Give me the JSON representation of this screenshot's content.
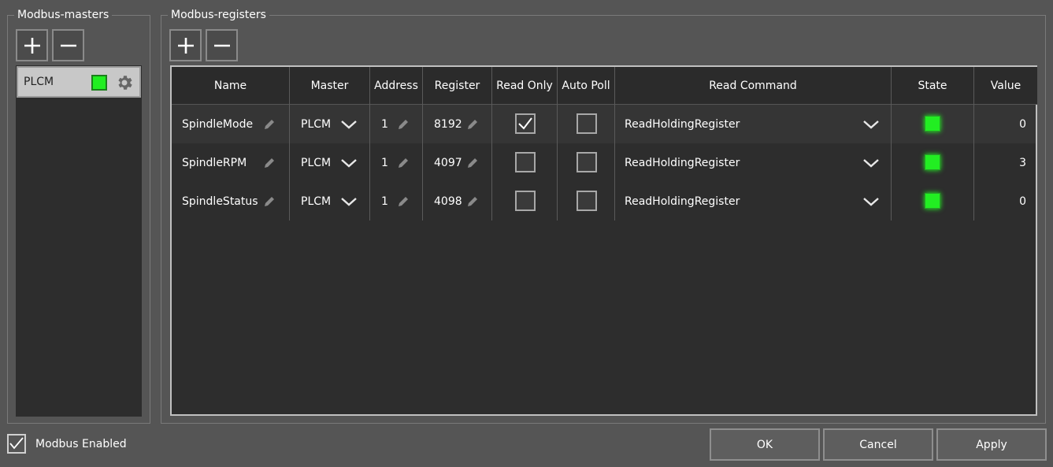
{
  "masters": {
    "title": "Modbus-masters",
    "items": [
      {
        "name": "PLCM",
        "status_color": "#21ee21"
      }
    ]
  },
  "registers": {
    "title": "Modbus-registers",
    "columns": [
      "Name",
      "Master",
      "Address",
      "Register",
      "Read Only",
      "Auto Poll",
      "Read Command",
      "State",
      "Value"
    ],
    "rows": [
      {
        "name": "SpindleMode",
        "master": "PLCM",
        "address": "1",
        "register": "8192",
        "read_only": true,
        "auto_poll": false,
        "read_command": "ReadHoldingRegister",
        "state": "on",
        "value": "0"
      },
      {
        "name": "SpindleRPM",
        "master": "PLCM",
        "address": "1",
        "register": "4097",
        "read_only": false,
        "auto_poll": false,
        "read_command": "ReadHoldingRegister",
        "state": "on",
        "value": "3"
      },
      {
        "name": "SpindleStatus",
        "master": "PLCM",
        "address": "1",
        "register": "4098",
        "read_only": false,
        "auto_poll": false,
        "read_command": "ReadHoldingRegister",
        "state": "on",
        "value": "0"
      }
    ]
  },
  "footer": {
    "modbus_enabled_label": "Modbus Enabled",
    "modbus_enabled": true,
    "ok_label": "OK",
    "cancel_label": "Cancel",
    "apply_label": "Apply"
  },
  "icons": {
    "add": "plus-icon",
    "remove": "minus-icon",
    "settings": "gear-icon",
    "edit": "pencil-icon",
    "dropdown": "chevron-down-icon",
    "check": "check-icon"
  },
  "colors": {
    "state_led": "#22ee22",
    "background": "#555555",
    "table_bg": "#2d2d2d"
  }
}
